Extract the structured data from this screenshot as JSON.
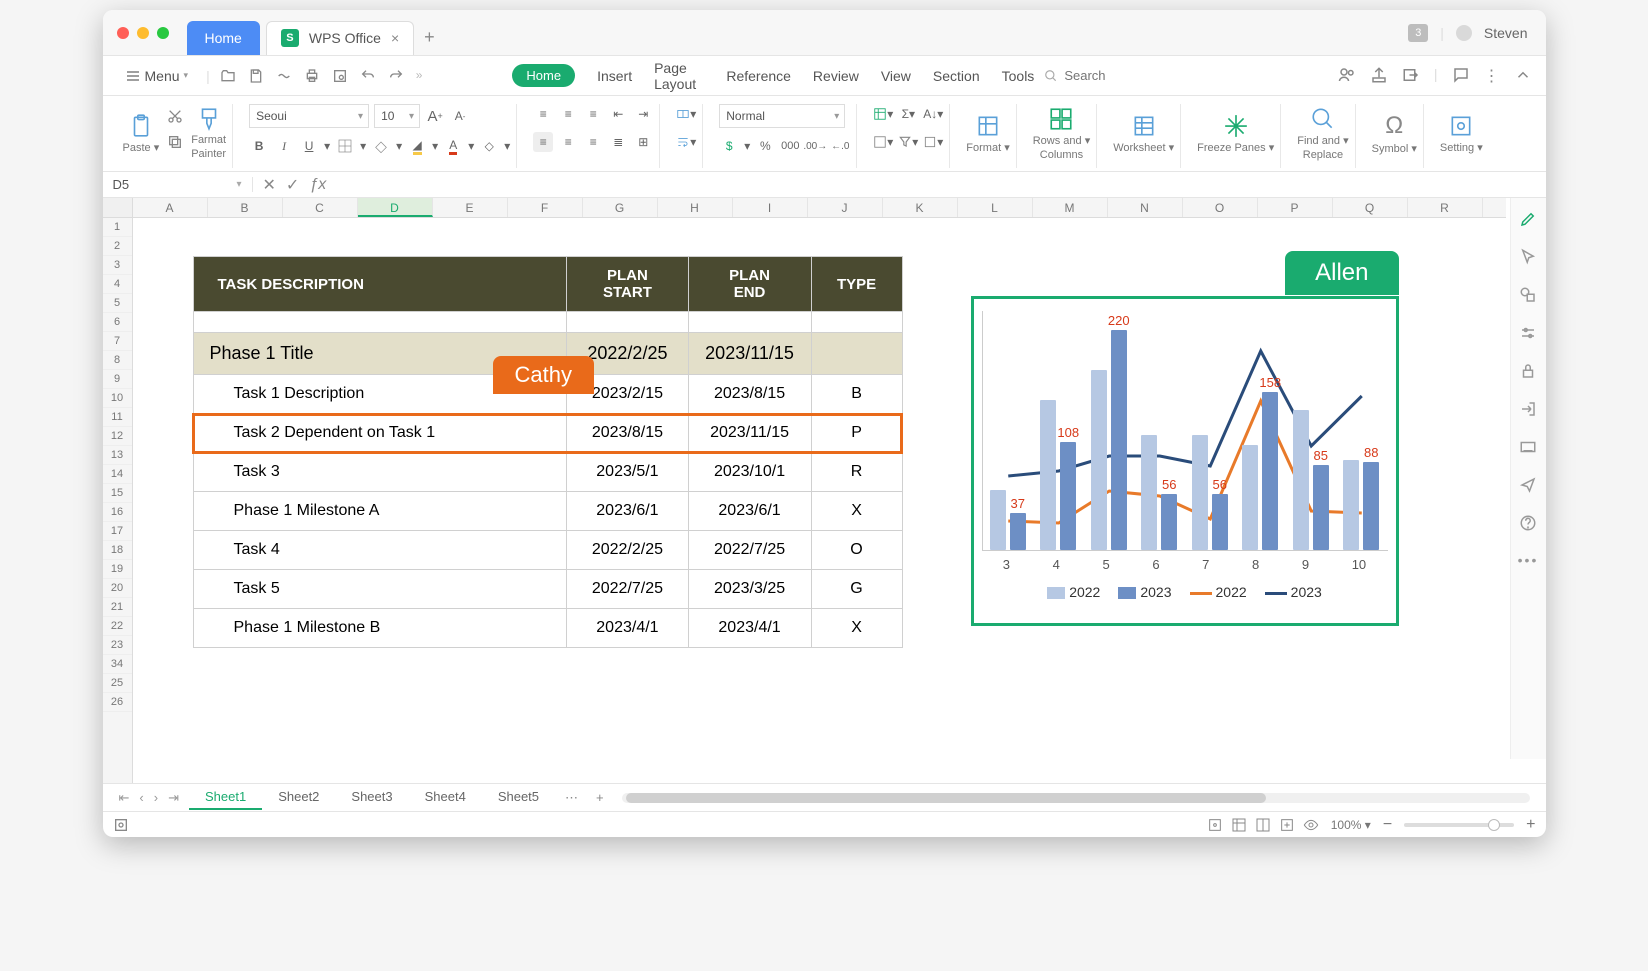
{
  "titlebar": {
    "home_tab": "Home",
    "doc_tab": "WPS Office",
    "doc_icon_letter": "S",
    "badge": "3",
    "user": "Steven"
  },
  "menubar": {
    "menu": "Menu",
    "items": [
      "Home",
      "Insert",
      "Page Layout",
      "Reference",
      "Review",
      "View",
      "Section",
      "Tools"
    ],
    "search_placeholder": "Search"
  },
  "ribbon": {
    "paste": "Paste",
    "format_painter_l1": "Farmat",
    "format_painter_l2": "Painter",
    "font_name": "Seoui",
    "font_size": "10",
    "number_format": "Normal",
    "format": "Format",
    "rows_cols_l1": "Rows and",
    "rows_cols_l2": "Columns",
    "worksheet": "Worksheet",
    "freeze": "Freeze Panes",
    "find_l1": "Find and",
    "find_l2": "Replace",
    "symbol": "Symbol",
    "setting": "Setting"
  },
  "formula_bar": {
    "name": "D5",
    "fx": "ƒx"
  },
  "grid": {
    "cols": [
      "A",
      "B",
      "C",
      "D",
      "E",
      "F",
      "G",
      "H",
      "I",
      "J",
      "K",
      "L",
      "M",
      "N",
      "O",
      "P",
      "Q",
      "R"
    ],
    "active_col": "D",
    "rows": [
      "1",
      "2",
      "3",
      "4",
      "5",
      "6",
      "7",
      "8",
      "9",
      "10",
      "11",
      "12",
      "13",
      "14",
      "15",
      "16",
      "17",
      "18",
      "19",
      "20",
      "21",
      "22",
      "23",
      "34",
      "25",
      "26"
    ]
  },
  "task_table": {
    "headers": {
      "desc": "TASK DESCRIPTION",
      "start": "PLAN\nSTART",
      "end": "PLAN\nEND",
      "type": "TYPE"
    },
    "phase": {
      "title": "Phase 1 Title",
      "start": "2022/2/25",
      "end": "2023/11/15"
    },
    "rows": [
      {
        "desc": "Task 1 Description",
        "start": "2023/2/15",
        "end": "2023/8/15",
        "type": "B"
      },
      {
        "desc": "Task 2 Dependent on Task 1",
        "start": "2023/8/15",
        "end": "2023/11/15",
        "type": "P"
      },
      {
        "desc": "Task 3",
        "start": "2023/5/1",
        "end": "2023/10/1",
        "type": "R"
      },
      {
        "desc": "Phase 1 Milestone A",
        "start": "2023/6/1",
        "end": "2023/6/1",
        "type": "X"
      },
      {
        "desc": "Task 4",
        "start": "2022/2/25",
        "end": "2022/7/25",
        "type": "O"
      },
      {
        "desc": "Task 5",
        "start": "2022/7/25",
        "end": "2023/3/25",
        "type": "G"
      },
      {
        "desc": "Phase 1 Milestone B",
        "start": "2023/4/1",
        "end": "2023/4/1",
        "type": "X"
      }
    ],
    "selected_row_index": 1,
    "collab_labels": {
      "cathy": "Cathy",
      "allen": "Allen"
    }
  },
  "chart_data": {
    "type": "bar+line",
    "categories": [
      "3",
      "4",
      "5",
      "6",
      "7",
      "8",
      "9",
      "10"
    ],
    "series": [
      {
        "name": "2022",
        "kind": "bar",
        "color": "#b6c8e3",
        "values": [
          60,
          150,
          180,
          115,
          115,
          105,
          140,
          90
        ]
      },
      {
        "name": "2023",
        "kind": "bar",
        "color": "#6d8fc5",
        "values": [
          37,
          108,
          220,
          56,
          56,
          158,
          85,
          88
        ]
      },
      {
        "name": "2022",
        "kind": "line",
        "color": "#e87a2a",
        "values": [
          30,
          28,
          60,
          55,
          32,
          150,
          40,
          38
        ]
      },
      {
        "name": "2023",
        "kind": "line",
        "color": "#2a4c7a",
        "values": [
          75,
          80,
          95,
          95,
          85,
          200,
          105,
          155
        ]
      }
    ],
    "data_labels": [
      37,
      108,
      220,
      56,
      56,
      158,
      85,
      88
    ],
    "ylim": [
      0,
      240
    ],
    "legend": [
      "2022",
      "2023",
      "2022",
      "2023"
    ]
  },
  "sheets": {
    "tabs": [
      "Sheet1",
      "Sheet2",
      "Sheet3",
      "Sheet4",
      "Sheet5"
    ],
    "active": 0
  },
  "status": {
    "zoom": "100%"
  }
}
